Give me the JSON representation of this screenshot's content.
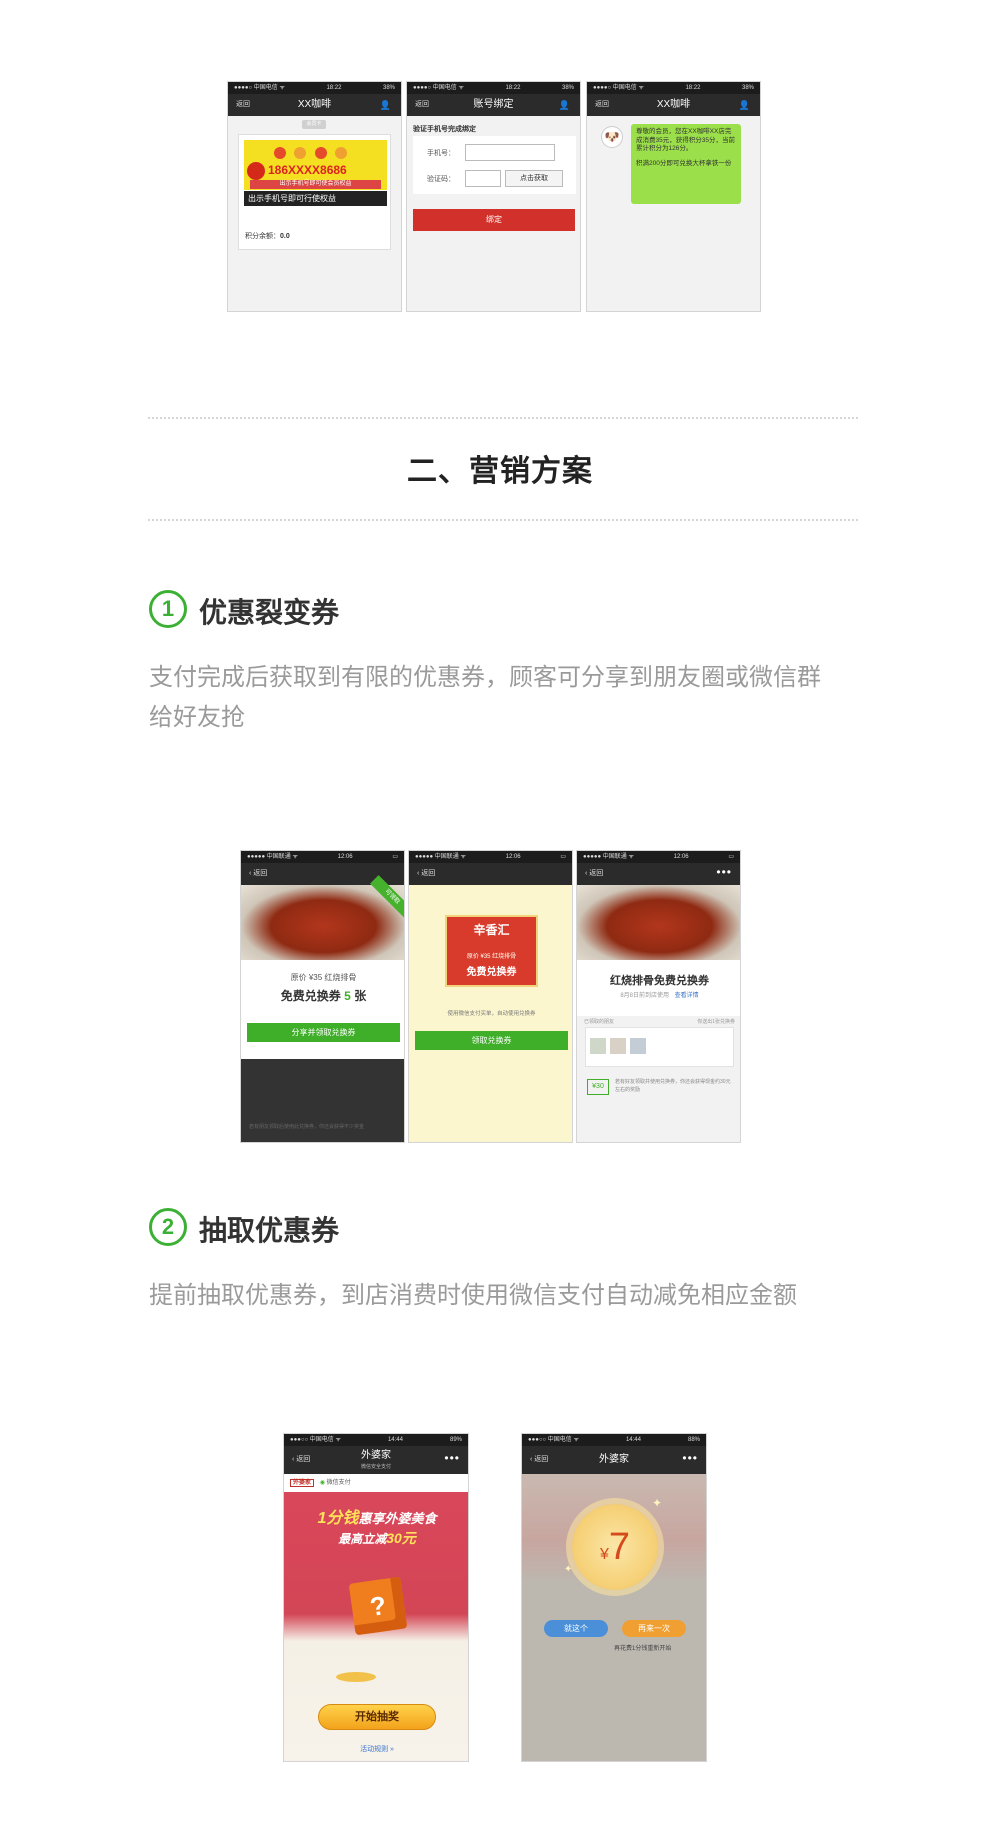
{
  "top_phones": {
    "status": {
      "carrier": "●●●●○ 中国电信 ᯤ",
      "time": "18:22",
      "battery": "38%"
    },
    "phone1": {
      "title": "XX咖啡",
      "back": "返回",
      "tag": "会员卡",
      "card_number": "186XXXX8686",
      "card_hint_small": "出示手机号即可使会员权益",
      "card_hint": "出示手机号即可行使权益",
      "points_label": "积分余额：",
      "points_value": "0.0"
    },
    "phone2": {
      "title": "账号绑定",
      "back": "返回",
      "heading": "验证手机号完成绑定",
      "phone_label": "手机号：",
      "code_label": "验证码：",
      "get_code": "点击获取",
      "bind": "绑定"
    },
    "phone3": {
      "title": "XX咖啡",
      "back": "返回",
      "message_1": "尊敬的会员，您在XX咖啡XX店完成消费35元，获得积分35分，当前累计积分为126分。",
      "message_2": "积满200分即可兑换大杯拿铁一份"
    }
  },
  "section": {
    "title": "二、营销方案"
  },
  "item1": {
    "number": "1",
    "title": "优惠裂变券",
    "description": "支付完成后获取到有限的优惠券，顾客可分享到朋友圈或微信群给好友抢",
    "status": {
      "carrier": "●●●●● 中国联通 ᯤ",
      "time": "12:06"
    },
    "back": "返回",
    "phone1": {
      "ribbon": "可领取",
      "price_text": "原价 ¥35 红烧排骨",
      "free_text": "免费兑换券",
      "count": "5",
      "count_unit": "张",
      "share_button": "分享并领取兑换券",
      "footer": "若有朋友领取后使用此兑换券，你还会获得不少奖金"
    },
    "phone2": {
      "brand": "辛香汇",
      "coupon_price": "原价 ¥35 红烧排骨",
      "coupon_free": "免费兑换券",
      "hint": "使用微信支付买单，自动使用兑换券",
      "get_button": "领取兑换券"
    },
    "phone3": {
      "title": "红烧排骨免费兑换券",
      "date": "8月8日前到店使用",
      "detail": "查看详情",
      "friends_label": "已领取的朋友",
      "friends_right": "你送出1张兑换券",
      "reward": "¥30",
      "reward_text": "若有好友领取并使用兑换券，你还会获得现金约30元左右的奖励"
    }
  },
  "item2": {
    "number": "2",
    "title": "抽取优惠券",
    "description": "提前抽取优惠券，到店消费时使用微信支付自动减免相应金额",
    "status": {
      "carrier": "●●●○○ 中国电信 ᯤ",
      "time": "14:44",
      "battery1": "89%",
      "battery2": "88%"
    },
    "phone1": {
      "back": "返回",
      "title": "外婆家",
      "subtitle": "微信安全支付",
      "brand": "外婆家",
      "pay": "微信支付",
      "headline_big": "1分钱",
      "headline_rest": "惠享外婆美食",
      "subline_pre": "最高立减",
      "subline_amount": "30元",
      "start_button": "开始抽奖",
      "rules": "活动规则"
    },
    "phone2": {
      "back": "返回",
      "title": "外婆家",
      "currency": "¥",
      "prize": "7",
      "accept": "就这个",
      "again": "再来一次",
      "again_hint": "再花费1分钱重新开始"
    }
  }
}
